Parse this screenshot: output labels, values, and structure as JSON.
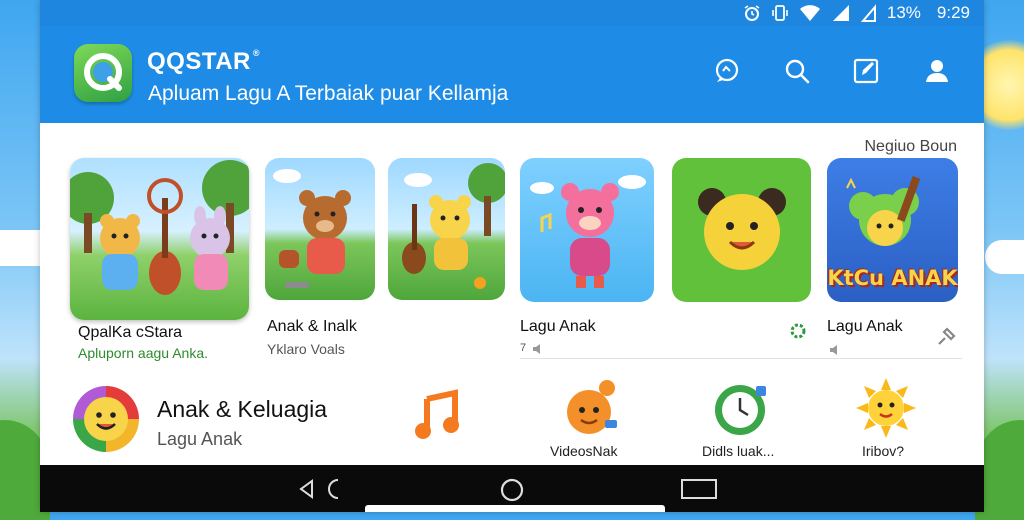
{
  "status_bar": {
    "clock": "9:29",
    "battery": "13%",
    "icons": [
      "alarm-icon",
      "vibrate-icon",
      "wifi-icon",
      "signal-icon",
      "signal-icon"
    ]
  },
  "app_bar": {
    "brand": "QQSTAR",
    "brand_mark": "®",
    "subtitle": "Apluam Lagu A Terbaiak puar Kellamja",
    "actions": [
      "chat-icon",
      "search-icon",
      "edit-icon",
      "profile-icon"
    ],
    "color": "#1e8ce6"
  },
  "section": {
    "link": "Negiuo Boun"
  },
  "featured": [
    {
      "title": "QpalKa cStara",
      "subtitle": "Apluporn aagu Anka.",
      "image": "bear-bunny-guitar"
    },
    {
      "title": "Anak & Inalk",
      "subtitle": "Yklaro Voals",
      "image": "brown-bear"
    },
    {
      "title": "",
      "subtitle": "",
      "image": "bear-guitar"
    },
    {
      "title": "Lagu Anak",
      "subtitle": "7",
      "image": "pink-bear"
    },
    {
      "title": "",
      "subtitle": "",
      "image": "yellow-face"
    },
    {
      "title": "Lagu Anak",
      "subtitle": "",
      "image": "kitty-anak",
      "badge": "KtCu ANAK"
    }
  ],
  "row2": {
    "title": "Anak & Keluagia",
    "subtitle": "Lagu Anak",
    "items": [
      {
        "label": "",
        "icon": "music-note-icon"
      },
      {
        "label": "VideosNak",
        "icon": "orange-character-icon"
      },
      {
        "label": "Didls luak...",
        "icon": "clock-icon"
      },
      {
        "label": "Iribov?",
        "icon": "sun-icon"
      }
    ]
  },
  "colors": {
    "accent": "#1e8ce6",
    "status": "#1f86e0",
    "green": "#2e8b2e"
  }
}
